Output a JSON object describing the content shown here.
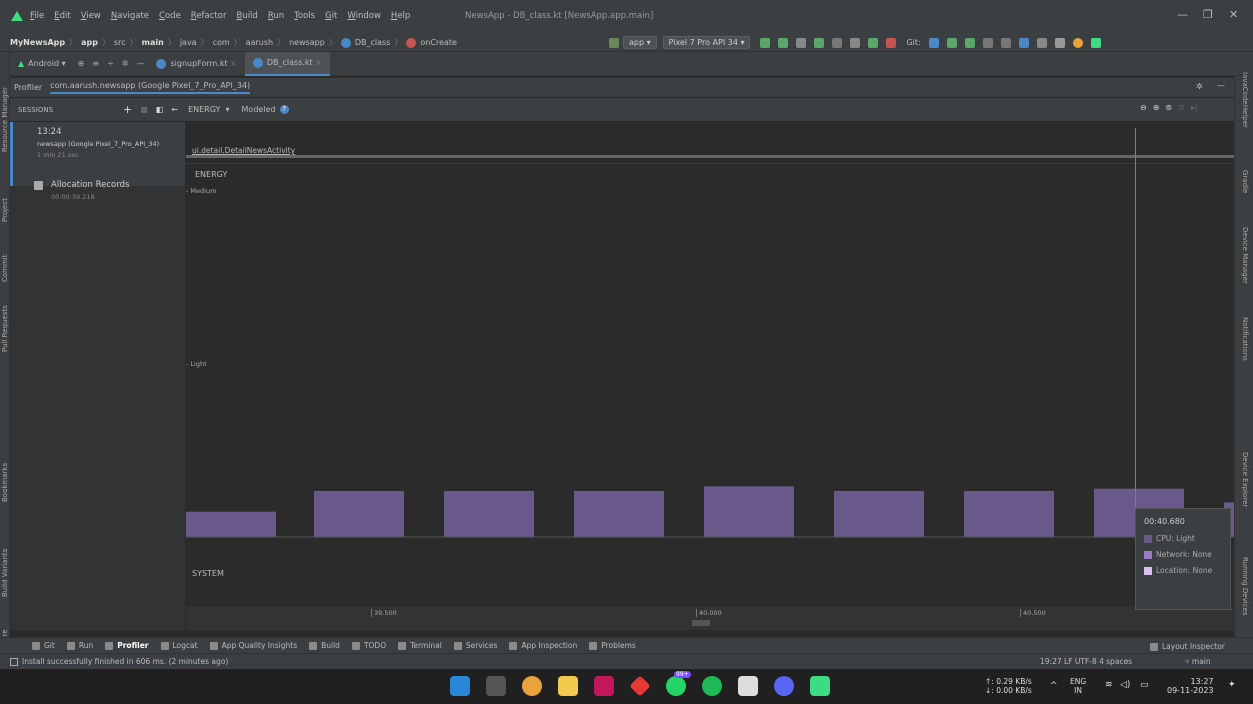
{
  "menubar": {
    "items": [
      "File",
      "Edit",
      "View",
      "Navigate",
      "Code",
      "Refactor",
      "Build",
      "Run",
      "Tools",
      "Git",
      "Window",
      "Help"
    ],
    "window_title": "NewsApp - DB_class.kt [NewsApp.app.main]"
  },
  "navbar": {
    "crumbs": [
      "MyNewsApp",
      "app",
      "src",
      "main",
      "java",
      "com",
      "aarush",
      "newsapp",
      "DB_class",
      "onCreate"
    ],
    "run_config": "app",
    "device": "Pixel 7 Pro API 34",
    "git_label": "Git:"
  },
  "tabs": {
    "project_view": "Android",
    "files": [
      "signupForm.kt",
      "DB_class.kt"
    ]
  },
  "left_tools": [
    "Resource Manager",
    "Project",
    "Commit",
    "Pull Requests",
    "Bookmarks",
    "Build Variants",
    "Structure"
  ],
  "right_tools": [
    "JavaCodeHelper",
    "Gradle",
    "Device Manager",
    "Notifications",
    "Device Explorer",
    "Running Devices"
  ],
  "profiler": {
    "tab_label": "Profiler",
    "process": "com.aarush.newsapp (Google Pixel_7_Pro_API_34)",
    "sessions_label": "SESSIONS",
    "view_label": "ENERGY",
    "modeled_label": "Modeled",
    "session": {
      "time": "13:24",
      "name": "newsapp (Google Pixel_7_Pro_API_34)",
      "duration": "1 min 21 sec"
    },
    "allocation": {
      "label": "Allocation Records",
      "time": "00:00:39.218"
    },
    "activity": "ui.detail.DetailNewsActivity",
    "energy_label": "ENERGY",
    "level_medium": "Medium",
    "level_light": "Light",
    "system_label": "SYSTEM",
    "ticks": [
      "39.500",
      "40.000",
      "40.500"
    ],
    "tooltip": {
      "time": "00:40.680",
      "cpu": "CPU: Light",
      "network": "Network: None",
      "location": "Location: None"
    },
    "bar_color": "#6a5a8c",
    "energy_bars": [
      0.22,
      0.4,
      0.4,
      0.4,
      0.44,
      0.4,
      0.4,
      0.42,
      0.3
    ]
  },
  "footer_tools": [
    "Git",
    "Run",
    "Profiler",
    "Logcat",
    "App Quality Insights",
    "Build",
    "TODO",
    "Terminal",
    "Services",
    "App Inspection",
    "Problems"
  ],
  "layout_inspector": "Layout Inspector",
  "status": {
    "message": "Install successfully finished in 606 ms. (2 minutes ago)",
    "right": "19:27  LF  UTF-8  4 spaces",
    "branch": "main"
  },
  "taskbar": {
    "net_up": "↑: 0.29 KB/s",
    "net_down": "↓: 0.00 KB/s",
    "lang": "ENG",
    "region": "IN",
    "time": "13:27",
    "date": "09-11-2023",
    "badge": "99+"
  },
  "colors": {
    "accent": "#4a88c7",
    "energy": "#6a5a8c",
    "tooltip_bg": "#3c3f41"
  }
}
